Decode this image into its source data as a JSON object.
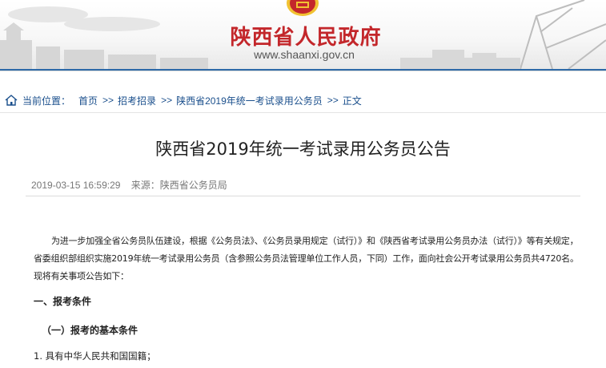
{
  "header": {
    "site_name": "陕西省人民政府",
    "site_url": "www.shaanxi.gov.cn"
  },
  "breadcrumb": {
    "icon": "home-icon",
    "label": "当前位置：",
    "items": [
      "首页",
      "招考招录",
      "陕西省2019年统一考试录用公务员",
      "正文"
    ],
    "separator": ">>"
  },
  "article": {
    "title": "陕西省2019年统一考试录用公务员公告",
    "date": "2019-03-15 16:59:29",
    "source": "来源：陕西省公务员局",
    "intro": "为进一步加强全省公务员队伍建设，根据《公务员法》、《公务员录用规定（试行）》和《陕西省考试录用公务员办法（试行）》等有关规定，省委组织部组织实施2019年统一考试录用公务员（含参照公务员法管理单位工作人员，下同）工作，面向社会公开考试录用公务员共4720名。现将有关事项公告如下：",
    "section1": "一、报考条件",
    "section1_sub": "（一）报考的基本条件",
    "item1": "1. 具有中华人民共和国国籍；"
  },
  "colors": {
    "brand_red": "#c3272b",
    "link_blue": "#1a4f8c"
  }
}
